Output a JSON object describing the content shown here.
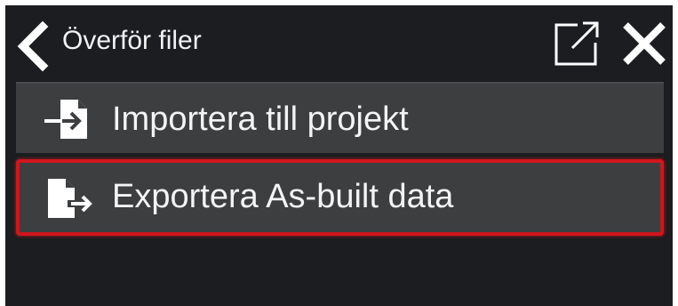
{
  "header": {
    "title": "Överför filer",
    "back_icon": "chevron-left-icon",
    "popout_icon": "external-link-icon",
    "close_icon": "close-icon"
  },
  "menu": {
    "items": [
      {
        "label": "Importera till projekt",
        "icon": "file-import-icon",
        "selected": false
      },
      {
        "label": "Exportera As-built data",
        "icon": "file-export-icon",
        "selected": true
      }
    ]
  },
  "colors": {
    "background": "#1b1d20",
    "item_background": "#3d3e40",
    "selection_border": "#d0161c",
    "text": "#f4f4f4"
  }
}
